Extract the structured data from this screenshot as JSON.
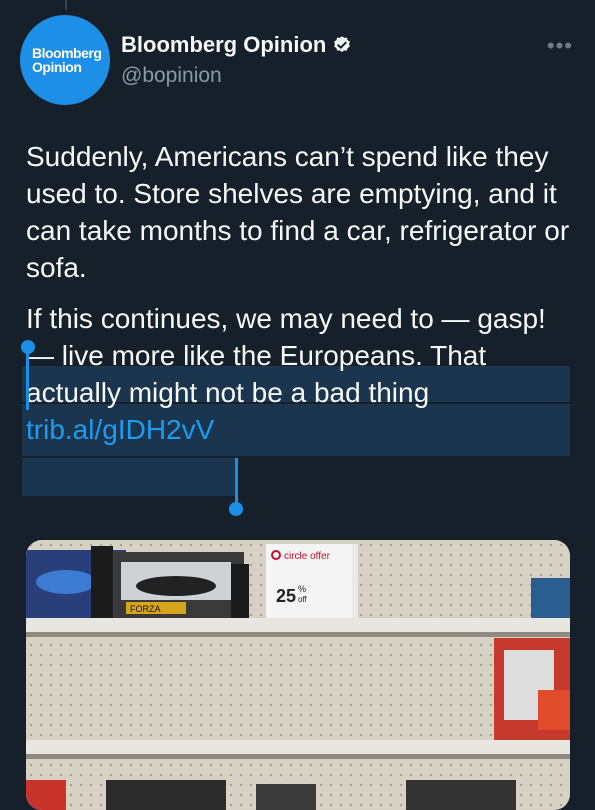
{
  "author": {
    "avatar_line1": "Bloomberg",
    "avatar_line2": "Opinion",
    "name": "Bloomberg Opinion",
    "handle": "@bopinion",
    "verified": true
  },
  "more_label": "•••",
  "tweet": {
    "paragraph1": "Suddenly, Americans can’t spend like they used to. Store shelves are emptying, and it can take months to find a car, refrigerator or sofa.",
    "paragraph2_text": "If this continues, we may need to — gasp! — live more like the Europeans. That actually might not be a bad thing",
    "link": "trib.al/gIDH2vV"
  },
  "media": {
    "sign_title": "circle offer",
    "sign_discount": "25",
    "sign_off": "off",
    "package_label": "FORZA"
  },
  "colors": {
    "background": "#15202b",
    "link": "#1d9bf0",
    "selection": "#1c3a56",
    "avatar": "#1d8fe6"
  }
}
